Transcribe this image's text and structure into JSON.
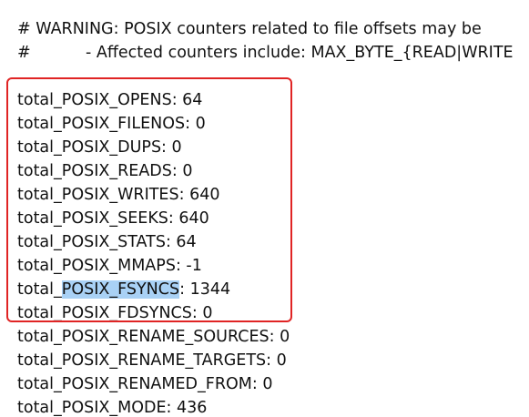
{
  "comments": [
    {
      "prefix": "#",
      "text": " WARNING: POSIX counters related to file offsets may be"
    },
    {
      "prefix": "#",
      "text": "- Affected counters include: MAX_BYTE_{READ|WRITE"
    }
  ],
  "counters": [
    {
      "name": "total_POSIX_OPENS",
      "value": "64"
    },
    {
      "name": "total_POSIX_FILENOS",
      "value": "0"
    },
    {
      "name": "total_POSIX_DUPS",
      "value": "0"
    },
    {
      "name": "total_POSIX_READS",
      "value": "0"
    },
    {
      "name": "total_POSIX_WRITES",
      "value": "640"
    },
    {
      "name": "total_POSIX_SEEKS",
      "value": "640"
    },
    {
      "name": "total_POSIX_STATS",
      "value": "64"
    },
    {
      "name": "total_POSIX_MMAPS",
      "value": "-1"
    },
    {
      "name_prefix": "total_",
      "name_highlight": "POSIX_FSYNCS",
      "value": "1344"
    },
    {
      "name": "total_POSIX_FDSYNCS",
      "value": "0"
    },
    {
      "name": "total_POSIX_RENAME_SOURCES",
      "value": "0"
    },
    {
      "name": "total_POSIX_RENAME_TARGETS",
      "value": "0"
    },
    {
      "name": "total_POSIX_RENAMED_FROM",
      "value": "0"
    },
    {
      "name": "total_POSIX_MODE",
      "value": "436"
    }
  ],
  "colors": {
    "annotation_box": "#e02424",
    "selection_highlight": "#a9d1f5"
  }
}
